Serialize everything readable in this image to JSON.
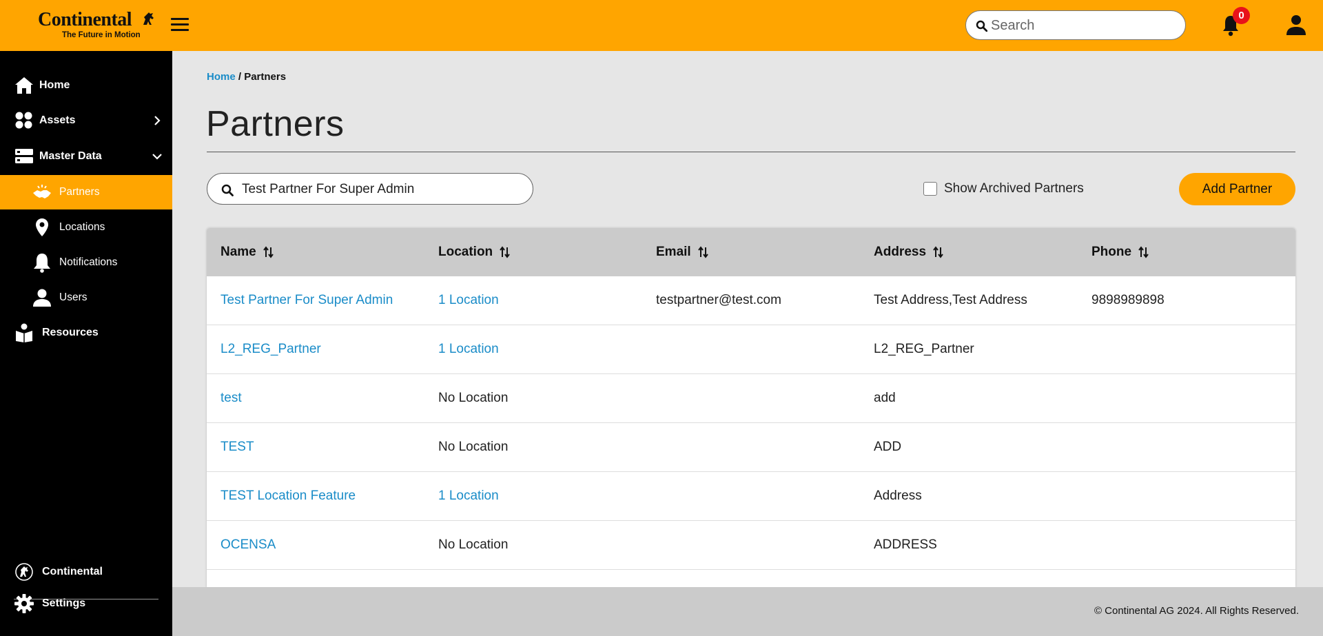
{
  "header": {
    "logo_name": "Continental",
    "logo_tagline": "The Future in Motion",
    "search_placeholder": "Search",
    "notification_count": "0"
  },
  "sidebar": {
    "items": [
      {
        "label": "Home",
        "icon": "home-icon"
      },
      {
        "label": "Assets",
        "icon": "assets-icon"
      },
      {
        "label": "Master Data",
        "icon": "master-data-icon"
      },
      {
        "label": "Partners",
        "icon": "handshake-icon",
        "active": true
      },
      {
        "label": "Locations",
        "icon": "location-pin-icon"
      },
      {
        "label": "Notifications",
        "icon": "bell-icon"
      },
      {
        "label": "Users",
        "icon": "user-icon"
      },
      {
        "label": "Resources",
        "icon": "book-reader-icon"
      }
    ],
    "bottom": [
      {
        "label": "Continental",
        "icon": "continental-emblem-icon"
      },
      {
        "label": "Settings",
        "icon": "gear-icon"
      }
    ]
  },
  "breadcrumb": {
    "home": "Home",
    "separator": " / ",
    "current": "Partners"
  },
  "page_title": "Partners",
  "filters": {
    "search_value": "Test Partner For Super Admin",
    "show_archived_label": "Show Archived Partners",
    "show_archived_checked": false,
    "add_button": "Add Partner"
  },
  "table": {
    "columns": [
      "Name",
      "Location",
      "Email",
      "Address",
      "Phone"
    ],
    "rows": [
      {
        "name": "Test Partner For Super Admin",
        "location": "1 Location",
        "location_link": true,
        "email": "testpartner@test.com",
        "address": "Test Address,Test Address",
        "phone": "9898989898"
      },
      {
        "name": "L2_REG_Partner",
        "location": "1 Location",
        "location_link": true,
        "email": "",
        "address": "L2_REG_Partner",
        "phone": ""
      },
      {
        "name": "test",
        "location": "No Location",
        "location_link": false,
        "email": "",
        "address": "add",
        "phone": ""
      },
      {
        "name": "TEST",
        "location": "No Location",
        "location_link": false,
        "email": "",
        "address": "ADD",
        "phone": ""
      },
      {
        "name": "TEST Location Feature",
        "location": "1 Location",
        "location_link": true,
        "email": "",
        "address": "Address",
        "phone": ""
      },
      {
        "name": "OCENSA",
        "location": "No Location",
        "location_link": false,
        "email": "",
        "address": "ADDRESS",
        "phone": ""
      }
    ]
  },
  "footer": {
    "copyright": "© Continental AG 2024. All Rights Reserved."
  },
  "colors": {
    "brand": "#ffa500",
    "link": "#1a8cc8",
    "sidebar": "#000000",
    "badge": "#e8121a"
  }
}
